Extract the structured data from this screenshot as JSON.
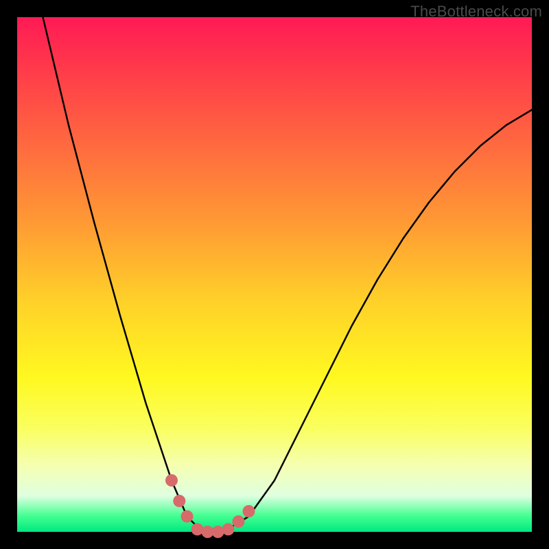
{
  "watermark": "TheBottleneck.com",
  "chart_data": {
    "type": "line",
    "title": "",
    "xlabel": "",
    "ylabel": "",
    "xlim": [
      0,
      100
    ],
    "ylim": [
      0,
      100
    ],
    "series": [
      {
        "name": "bottleneck-curve",
        "x": [
          5,
          10,
          15,
          20,
          25,
          30,
          33,
          36,
          40,
          45,
          50,
          55,
          60,
          65,
          70,
          75,
          80,
          85,
          90,
          95,
          100
        ],
        "values": [
          100,
          79,
          60,
          42,
          25,
          10,
          3,
          0,
          0,
          3,
          10,
          20,
          30,
          40,
          49,
          57,
          64,
          70,
          75,
          79,
          82
        ]
      }
    ],
    "markers": {
      "name": "highlight-dots",
      "x": [
        30,
        31.5,
        33,
        35,
        37,
        39,
        41,
        43,
        45
      ],
      "y": [
        10,
        6,
        3,
        0.5,
        0,
        0,
        0.5,
        2,
        4
      ]
    }
  }
}
